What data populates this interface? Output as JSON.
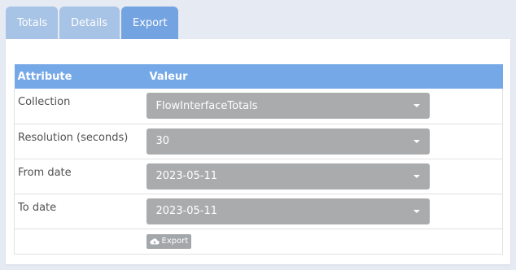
{
  "tabs": [
    {
      "label": "Totals"
    },
    {
      "label": "Details"
    },
    {
      "label": "Export",
      "active": true
    }
  ],
  "table": {
    "headers": {
      "attribute": "Attribute",
      "value": "Valeur"
    },
    "rows": [
      {
        "attribute": "Collection",
        "value": "FlowInterfaceTotals"
      },
      {
        "attribute": "Resolution (seconds)",
        "value": "30"
      },
      {
        "attribute": "From date",
        "value": "2023-05-11"
      },
      {
        "attribute": "To date",
        "value": "2023-05-11"
      }
    ]
  },
  "export_button": {
    "label": "Export",
    "icon": "cloud-download-icon"
  },
  "colors": {
    "tab_active": "#74a3e2",
    "tab_inactive": "#a7c3e6",
    "header_bg": "#74a8e7",
    "select_bg": "#a9abad"
  }
}
